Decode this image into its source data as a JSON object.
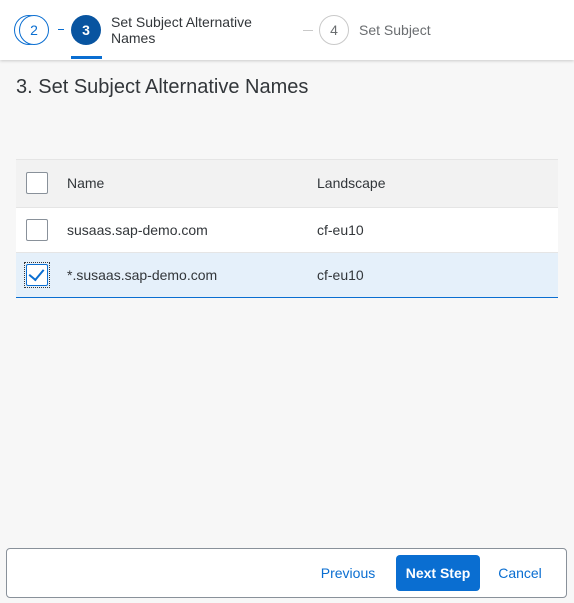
{
  "wizard": {
    "step2": {
      "number": "2"
    },
    "step3": {
      "number": "3",
      "label": "Set Subject Alternative Names"
    },
    "step4": {
      "number": "4",
      "label": "Set Subject"
    }
  },
  "page": {
    "title": "3. Set Subject Alternative Names"
  },
  "table": {
    "columns": [
      "Name",
      "Landscape"
    ],
    "rows": [
      {
        "name": "susaas.sap-demo.com",
        "landscape": "cf-eu10",
        "selected": false
      },
      {
        "name": "*.susaas.sap-demo.com",
        "landscape": "cf-eu10",
        "selected": true
      }
    ]
  },
  "footer": {
    "previous_label": "Previous",
    "next_label": "Next Step",
    "cancel_label": "Cancel"
  },
  "colors": {
    "accent": "#0a6ed1",
    "active_step": "#0854a0",
    "selected_row": "#e5f0fa"
  }
}
